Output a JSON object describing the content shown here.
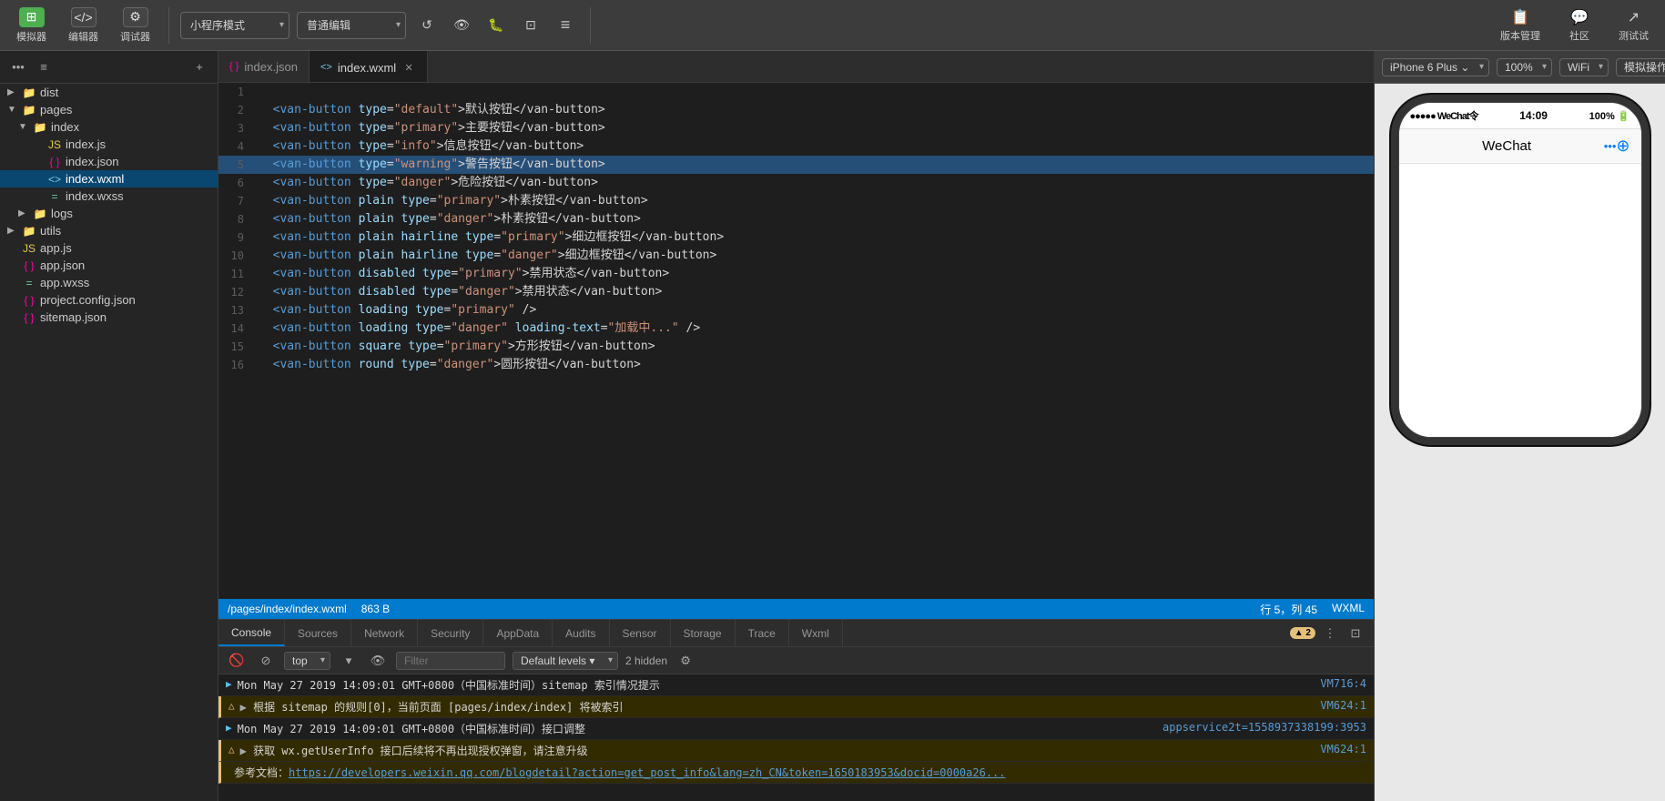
{
  "toolbar": {
    "simulator_label": "模拟器",
    "editor_label": "编辑器",
    "debug_label": "调试器",
    "miniapp_mode_label": "小程序模式",
    "normal_editor_label": "普通编辑",
    "compile_label": "编译",
    "preview_label": "预览",
    "real_machine_debug_label": "真机调试",
    "cut_page_label": "切后台",
    "clear_cache_label": "清缓存",
    "version_manage_label": "版本管理",
    "community_label": "社区",
    "test_label": "测试试"
  },
  "sidebar": {
    "items": [
      {
        "name": "dist",
        "type": "folder",
        "indent": 0,
        "expanded": false
      },
      {
        "name": "pages",
        "type": "folder",
        "indent": 0,
        "expanded": true
      },
      {
        "name": "index",
        "type": "folder",
        "indent": 1,
        "expanded": true
      },
      {
        "name": "index.js",
        "type": "js",
        "indent": 2
      },
      {
        "name": "index.json",
        "type": "json",
        "indent": 2
      },
      {
        "name": "index.wxml",
        "type": "wxml",
        "indent": 2,
        "active": true
      },
      {
        "name": "index.wxss",
        "type": "wxss",
        "indent": 2
      },
      {
        "name": "logs",
        "type": "folder",
        "indent": 1,
        "expanded": false
      },
      {
        "name": "utils",
        "type": "folder",
        "indent": 0,
        "expanded": false
      },
      {
        "name": "app.js",
        "type": "js",
        "indent": 0
      },
      {
        "name": "app.json",
        "type": "json",
        "indent": 0
      },
      {
        "name": "app.wxss",
        "type": "wxss",
        "indent": 0
      },
      {
        "name": "project.config.json",
        "type": "json",
        "indent": 0
      },
      {
        "name": "sitemap.json",
        "type": "json",
        "indent": 0
      }
    ]
  },
  "tabs": [
    {
      "id": "index-json",
      "label": "index.json",
      "active": false
    },
    {
      "id": "index-wxml",
      "label": "index.wxml",
      "active": true,
      "closeable": true
    }
  ],
  "code_lines": [
    {
      "num": 1,
      "content": ""
    },
    {
      "num": 2,
      "content": "  <van-button type=\"default\">默认按钮</van-button>"
    },
    {
      "num": 3,
      "content": "  <van-button type=\"primary\">主要按钮</van-button>"
    },
    {
      "num": 4,
      "content": "  <van-button type=\"info\">信息按钮</van-button>"
    },
    {
      "num": 5,
      "content": "  <van-button type=\"warning\">警告按钮</van-button>",
      "highlighted": true
    },
    {
      "num": 6,
      "content": "  <van-button type=\"danger\">危险按钮</van-button>"
    },
    {
      "num": 7,
      "content": "  <van-button plain type=\"primary\">朴素按钮</van-button>"
    },
    {
      "num": 8,
      "content": "  <van-button plain type=\"danger\">朴素按钮</van-button>"
    },
    {
      "num": 9,
      "content": "  <van-button plain hairline type=\"primary\">细边框按钮</van-button>"
    },
    {
      "num": 10,
      "content": "  <van-button plain hairline type=\"danger\">细边框按钮</van-button>"
    },
    {
      "num": 11,
      "content": "  <van-button disabled type=\"primary\">禁用状态</van-button>"
    },
    {
      "num": 12,
      "content": "  <van-button disabled type=\"danger\">禁用状态</van-button>"
    },
    {
      "num": 13,
      "content": "  <van-button loading type=\"primary\" />"
    },
    {
      "num": 14,
      "content": "  <van-button loading type=\"danger\" loading-text=\"加载中...\" />"
    },
    {
      "num": 15,
      "content": "  <van-button square type=\"primary\">方形按钮</van-button>"
    },
    {
      "num": 16,
      "content": "  <van-button round type=\"danger\">圆形按钮</van-button>"
    }
  ],
  "status_bar": {
    "path": "/pages/index/index.wxml",
    "size": "863 B",
    "row": "行 5，列 45",
    "lang": "WXML"
  },
  "bottom_panel": {
    "tabs": [
      {
        "id": "console",
        "label": "Console",
        "active": true
      },
      {
        "id": "sources",
        "label": "Sources"
      },
      {
        "id": "network",
        "label": "Network"
      },
      {
        "id": "security",
        "label": "Security"
      },
      {
        "id": "appdata",
        "label": "AppData"
      },
      {
        "id": "audits",
        "label": "Audits"
      },
      {
        "id": "sensor",
        "label": "Sensor"
      },
      {
        "id": "storage",
        "label": "Storage"
      },
      {
        "id": "trace",
        "label": "Trace"
      },
      {
        "id": "wxml",
        "label": "Wxml"
      }
    ],
    "filter_placeholder": "Filter",
    "level_options": [
      "Default levels"
    ],
    "top_option": "top",
    "hidden_count": "2 hidden",
    "badge_count": "2",
    "console_entries": [
      {
        "type": "info",
        "icon": "▶",
        "text": "Mon May 27 2019 14:09:01 GMT+0800（中国标准时间）sitemap 索引情况提示",
        "source": "VM716:4"
      },
      {
        "type": "warning",
        "icon": "△",
        "text": "▶  根据 sitemap 的规则[0]，当前页面 [pages/index/index] 将被索引",
        "source": "VM624:1"
      },
      {
        "type": "info",
        "icon": "▶",
        "text": "Mon May 27 2019 14:09:01 GMT+0800（中国标准时间）接口调整",
        "source": "appservice2t=1558937338199:3953"
      },
      {
        "type": "warning",
        "icon": "△",
        "text": "▶  获取 wx.getUserInfo 接口后续将不再出现授权弹窗，请注意升级",
        "source": "VM624:1"
      },
      {
        "type": "warning",
        "icon": "",
        "text": "参考文档：https://developers.weixin.qq.com/blogdetail?action=get_post_info&lang=zh_CN&token=1650183953&docid=0000a26...",
        "link": "https://developers.weixin.qq.com/blogdetail?action=get_post_info&lang=zh_CN&token=1650183953&docid=0000a26...",
        "source": ""
      }
    ]
  },
  "preview": {
    "device": "iPhone 6 Plus",
    "zoom": "100%",
    "network": "WiFi",
    "action": "模拟操作",
    "status_bar": {
      "signal": "●●●●●",
      "carrier": "WeChat",
      "wifi": "WiFi",
      "time": "14:09",
      "battery": "100%"
    },
    "nav_bar": {
      "title": "WeChat",
      "dots": "•••"
    }
  }
}
